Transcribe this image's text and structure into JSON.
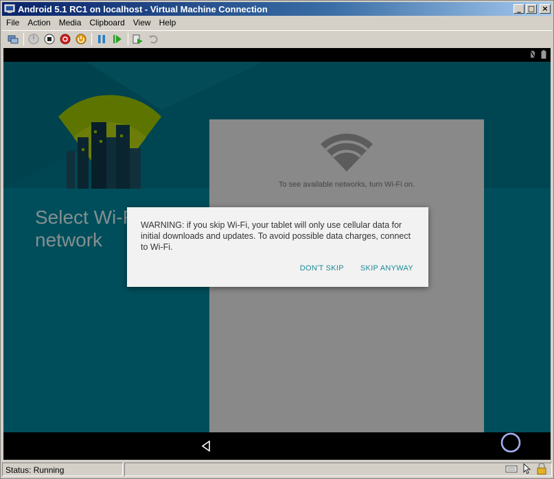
{
  "window": {
    "title": "Android 5.1 RC1 on localhost - Virtual Machine Connection",
    "buttons": {
      "minimize": "_",
      "maximize": "□",
      "close": "×"
    }
  },
  "menu": {
    "items": [
      "File",
      "Action",
      "Media",
      "Clipboard",
      "View",
      "Help"
    ]
  },
  "toolbar": {
    "icons": [
      "ctrl-alt-del-icon",
      "start-icon",
      "turn-off-icon",
      "shutdown-icon",
      "save-icon",
      "pause-icon",
      "resume-icon",
      "snapshot-icon",
      "revert-icon"
    ],
    "colors": {
      "red": "#cc2222",
      "orange": "#e39a12",
      "blue": "#1f7ec8",
      "green": "#2aa22a"
    }
  },
  "android": {
    "setup_title": "Select Wi-Fi network",
    "setup_title_visible_line1": "Select Wi-F",
    "setup_title_visible_line2": "network",
    "wifi_hint": "To see available networks, turn Wi-Fi on.",
    "dialog": {
      "message": "WARNING: if you skip Wi-Fi, your tablet will only use cellular data for initial downloads and updates. To avoid possible data charges, connect to Wi-Fi.",
      "dont_skip": "DON'T SKIP",
      "skip_anyway": "SKIP ANYWAY"
    },
    "colors": {
      "teal_bg": "#006c7e",
      "accent": "#1b8a95"
    }
  },
  "status": {
    "text": "Status: Running"
  }
}
